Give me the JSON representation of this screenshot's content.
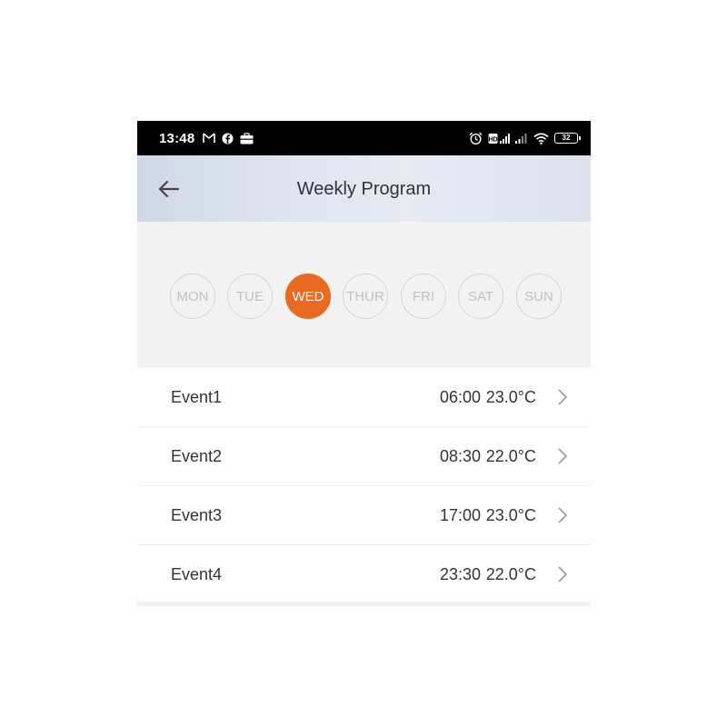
{
  "status_bar": {
    "time": "13:48",
    "battery": "32",
    "left_icons": [
      "message-icon",
      "facebook-icon",
      "briefcase-icon"
    ],
    "right_icons": [
      "alarm-icon",
      "hd-signal-icon",
      "signal-icon",
      "signal-icon-2",
      "wifi-icon",
      "battery-icon"
    ]
  },
  "header": {
    "title": "Weekly Program",
    "back_icon": "arrow-left-icon",
    "background": "#dde4ee"
  },
  "days": [
    {
      "label": "MON",
      "active": false
    },
    {
      "label": "TUE",
      "active": false
    },
    {
      "label": "WED",
      "active": true
    },
    {
      "label": "THUR",
      "active": false
    },
    {
      "label": "FRI",
      "active": false
    },
    {
      "label": "SAT",
      "active": false
    },
    {
      "label": "SUN",
      "active": false
    }
  ],
  "accent_color": "#ea6a22",
  "events": [
    {
      "name": "Event1",
      "time": "06:00",
      "temp": "23.0°C"
    },
    {
      "name": "Event2",
      "time": "08:30",
      "temp": "22.0°C"
    },
    {
      "name": "Event3",
      "time": "17:00",
      "temp": "23.0°C"
    },
    {
      "name": "Event4",
      "time": "23:30",
      "temp": "22.0°C"
    }
  ]
}
